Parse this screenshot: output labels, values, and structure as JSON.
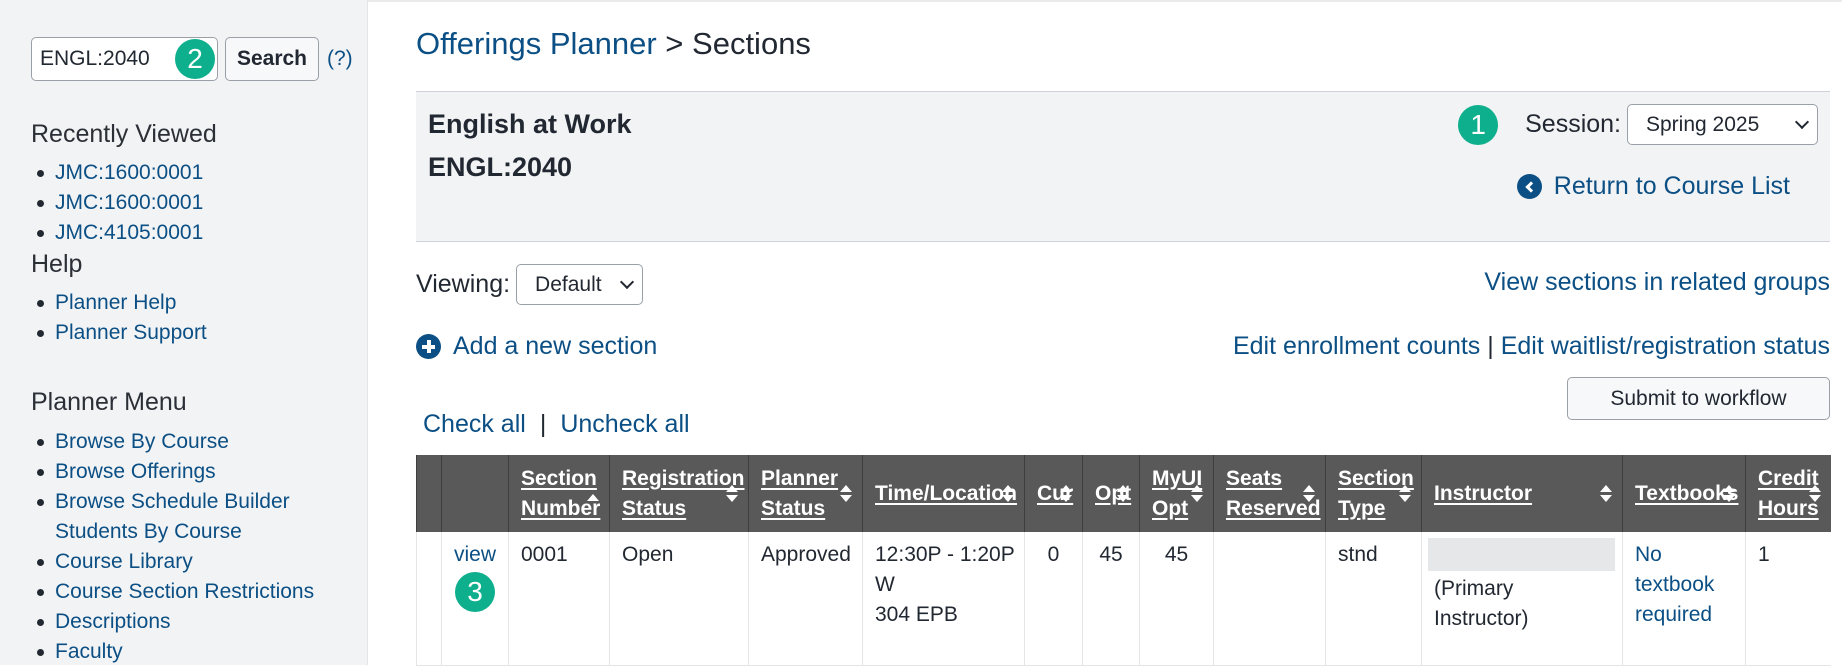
{
  "sidebar": {
    "search": {
      "value": "ENGL:2040",
      "button": "Search",
      "help": "(?)",
      "badge": "2"
    },
    "recently_viewed": {
      "heading": "Recently Viewed",
      "items": [
        "JMC:1600:0001",
        "JMC:1600:0001",
        "JMC:4105:0001"
      ]
    },
    "help": {
      "heading": "Help",
      "items": [
        "Planner Help",
        "Planner Support"
      ]
    },
    "planner_menu": {
      "heading": "Planner Menu",
      "items": [
        "Browse By Course",
        "Browse Offerings",
        "Browse Schedule Builder",
        "Students By Course",
        "Course Library",
        "Course Section Restrictions",
        "Descriptions",
        "Faculty"
      ]
    }
  },
  "header": {
    "breadcrumb_link": "Offerings Planner",
    "breadcrumb_sep": " > ",
    "breadcrumb_current": "Sections"
  },
  "course": {
    "title": "English at Work",
    "code": "ENGL:2040",
    "session_label": "Session:",
    "session_value": "Spring 2025",
    "session_badge": "1",
    "return_link": "Return to Course List"
  },
  "controls": {
    "viewing_label": "Viewing:",
    "viewing_value": "Default",
    "related_link": "View sections in related groups",
    "add_section": "Add a new section",
    "edit_enrollment": "Edit enrollment counts",
    "edit_sep": " | ",
    "edit_waitlist": "Edit waitlist/registration status",
    "submit": "Submit to workflow",
    "check_all": "Check all",
    "check_sep": "|",
    "uncheck_all": "Uncheck all"
  },
  "table": {
    "headers": [
      {
        "l1": "",
        "l2": ""
      },
      {
        "l1": "",
        "l2": ""
      },
      {
        "l1": "Section",
        "l2": "Number"
      },
      {
        "l1": "Registration",
        "l2": "Status"
      },
      {
        "l1": "Planner",
        "l2": "Status"
      },
      {
        "l1": "Time/Location",
        "l2": ""
      },
      {
        "l1": "Cur",
        "l2": ""
      },
      {
        "l1": "Opt",
        "l2": ""
      },
      {
        "l1": "MyUI",
        "l2": "Opt"
      },
      {
        "l1": "Seats",
        "l2": "Reserved"
      },
      {
        "l1": "Section",
        "l2": "Type"
      },
      {
        "l1": "Instructor",
        "l2": ""
      },
      {
        "l1": "Textbooks",
        "l2": ""
      },
      {
        "l1": "Credit",
        "l2": "Hours"
      }
    ],
    "rows": [
      {
        "view": "view",
        "badge": "3",
        "section_number": "0001",
        "registration_status": "Open",
        "planner_status": "Approved",
        "time": "12:30P - 1:20P",
        "days": "W",
        "location": "304 EPB",
        "cur": "0",
        "opt": "45",
        "myui_opt": "45",
        "seats_reserved": "",
        "section_type": "stnd",
        "instructor_role": "(Primary Instructor)",
        "textbook": "No textbook required",
        "credit_hours": "1"
      }
    ]
  }
}
